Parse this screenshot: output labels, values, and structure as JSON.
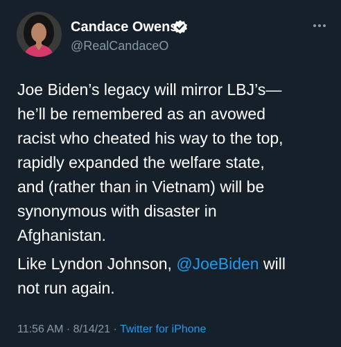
{
  "author": {
    "display_name": "Candace Owens",
    "handle": "@RealCandaceO",
    "verified_icon": "verified-badge-icon"
  },
  "tweet": {
    "paragraph_1_lines": [
      "Joe Biden’s legacy will mirror LBJ’s—",
      "he’ll be remembered as an avowed",
      "racist who cheated his way to the top,",
      "rapidly expanded the welfare state,",
      "and (rather than in Vietnam) will be",
      "synonymous with disaster in",
      "Afghanistan."
    ],
    "paragraph_2": {
      "line_1_before": "Like Lyndon Johnson, ",
      "mention": "@JoeBiden",
      "line_1_after": " will",
      "line_2": "not run again."
    }
  },
  "meta": {
    "time": "11:56 AM",
    "separator_1": " · ",
    "date": "8/14/21",
    "separator_2": " · ",
    "source": "Twitter for iPhone"
  },
  "colors": {
    "background": "#15202b",
    "link": "#1d9bf0",
    "secondary_text": "#8899a6"
  }
}
